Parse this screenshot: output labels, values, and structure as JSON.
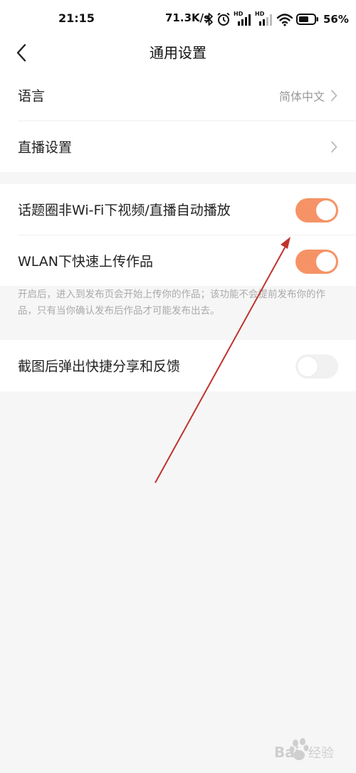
{
  "status_bar": {
    "time": "21:15",
    "net_speed": "71.3K/s",
    "battery": "56%",
    "signal_1_label": "HD",
    "signal_2_label": "HD"
  },
  "nav": {
    "title": "通用设置"
  },
  "settings": {
    "language": {
      "label": "语言",
      "value": "简体中文"
    },
    "live": {
      "label": "直播设置"
    },
    "autoplay": {
      "label": "话题圈非Wi-Fi下视频/直播自动播放",
      "enabled": true
    },
    "wlan_upload": {
      "label": "WLAN下快速上传作品",
      "enabled": true
    },
    "wlan_note": "开启后，进入到发布页会开始上传你的作品；该功能不会提前发布你的作品，只有当你确认发布后作品才可能发布出去。",
    "screenshot_share": {
      "label": "截图后弹出快捷分享和反馈",
      "enabled": false
    }
  },
  "colors": {
    "accent": "#f59366",
    "annotation_arrow": "#c0322c",
    "background": "#f6f6f6"
  },
  "watermark": {
    "text": "Bai经验"
  }
}
